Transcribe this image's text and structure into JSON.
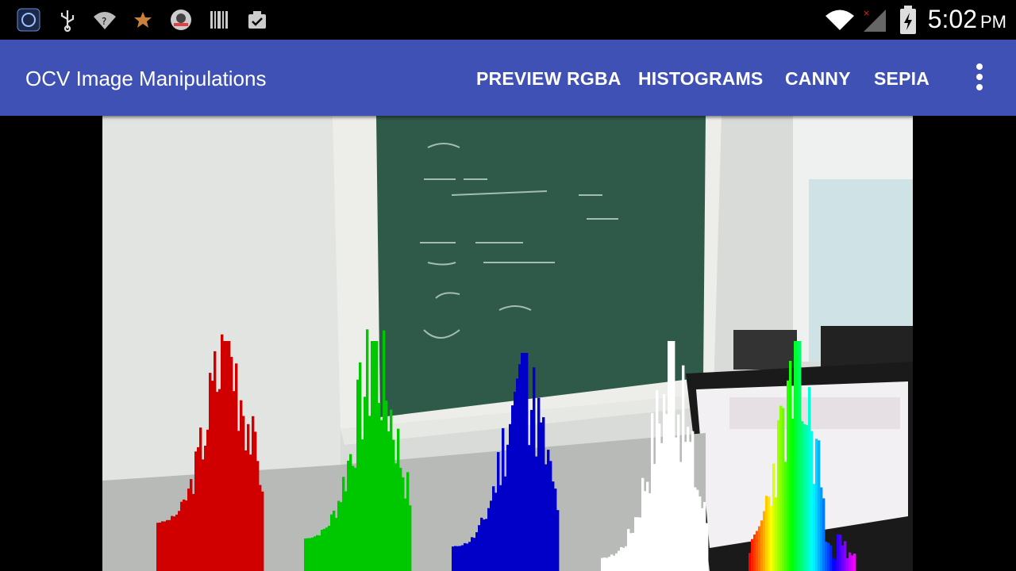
{
  "status_bar": {
    "time": "5:02",
    "ampm": "PM",
    "left_icons": [
      "app-notification-icon",
      "usb-icon",
      "wifi-question-icon",
      "star-icon",
      "avatar-app-icon",
      "barcode-icon",
      "clipboard-check-icon"
    ],
    "right_icons": [
      "wifi-icon",
      "signal-no-service-icon",
      "battery-charging-icon"
    ]
  },
  "app_bar": {
    "title": "OCV Image Manipulations",
    "actions": [
      "PREVIEW RGBA",
      "HISTOGRAMS",
      "CANNY",
      "SEPIA"
    ],
    "overflow_icon": "more-vert-icon",
    "color": "#3f51b5"
  },
  "camera_preview": {
    "mode": "HISTOGRAMS",
    "channels": [
      {
        "name": "red",
        "color": "#d00000"
      },
      {
        "name": "green",
        "color": "#00c800"
      },
      {
        "name": "blue",
        "color": "#0000c8"
      },
      {
        "name": "white",
        "color": "#ffffff"
      },
      {
        "name": "hue",
        "color": "spectrum"
      }
    ]
  }
}
